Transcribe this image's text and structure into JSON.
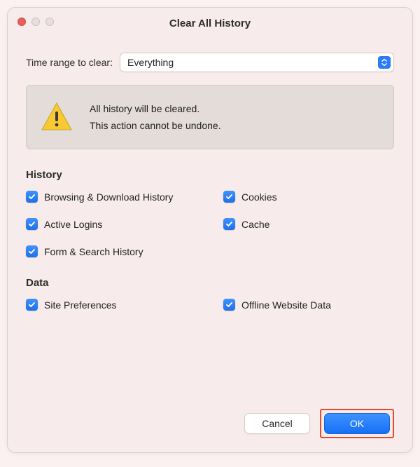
{
  "window": {
    "title": "Clear All History"
  },
  "range": {
    "label": "Time range to clear:",
    "value": "Everything"
  },
  "warning": {
    "line1": "All history will be cleared.",
    "line2": "This action cannot be undone."
  },
  "sections": {
    "history": {
      "title": "History",
      "items": [
        {
          "label": "Browsing & Download History",
          "checked": true
        },
        {
          "label": "Cookies",
          "checked": true
        },
        {
          "label": "Active Logins",
          "checked": true
        },
        {
          "label": "Cache",
          "checked": true
        },
        {
          "label": "Form & Search History",
          "checked": true
        }
      ]
    },
    "data": {
      "title": "Data",
      "items": [
        {
          "label": "Site Preferences",
          "checked": true
        },
        {
          "label": "Offline Website Data",
          "checked": true
        }
      ]
    }
  },
  "buttons": {
    "cancel": "Cancel",
    "ok": "OK"
  }
}
